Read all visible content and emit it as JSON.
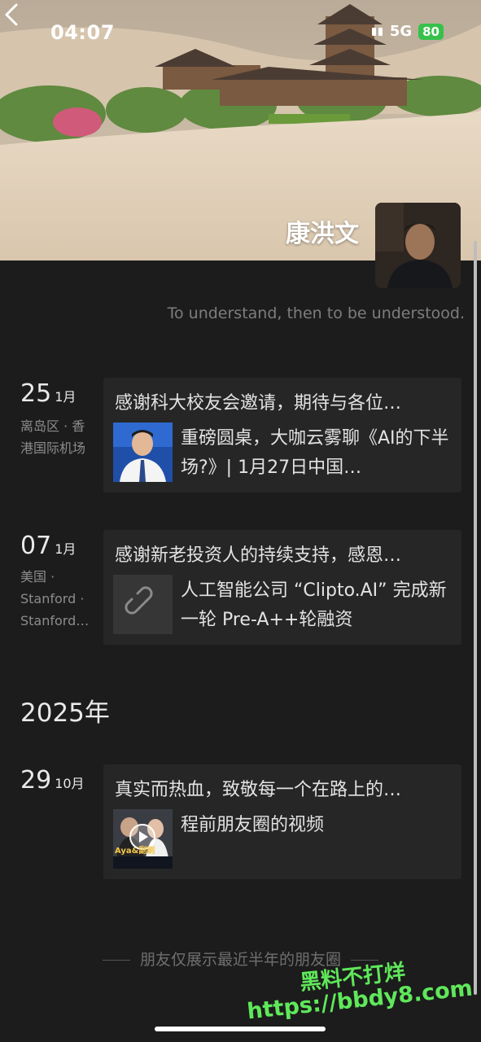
{
  "status_bar": {
    "time": "04:07",
    "network": "5G",
    "battery": "80"
  },
  "profile": {
    "name": "康洪文",
    "signature": "To understand, then to be understood."
  },
  "posts": [
    {
      "day": "25",
      "month": "1月",
      "location": "离岛区 · 香港国际机场",
      "caption": "感谢科大校友会邀请，期待与各位…",
      "link_text": "重磅圆桌，大咖云雾聊《AI的下半场?》| 1月27日中国…",
      "thumb": "person-photo-icon"
    },
    {
      "day": "07",
      "month": "1月",
      "location": "美国 · Stanford · Stanford…",
      "caption": "感谢新老投资人的持续支持，感恩…",
      "link_text": "人工智能公司 “Clipto.AI” 完成新一轮 Pre-A++轮融资",
      "thumb": "link-icon"
    },
    {
      "day": "29",
      "month": "10月",
      "location": "",
      "caption": "真实而热血，致敬每一个在路上的…",
      "link_text": "程前朋友圈的视频",
      "thumb": "video-play-icon",
      "thumb_text": "Aya&副刷"
    }
  ],
  "year_label": "2025年",
  "footer_note": "朋友仅展示最近半年的朋友圈",
  "watermark": {
    "line1": "黑料不打烊",
    "line2": "https://bbdy8.com"
  },
  "colors": {
    "background": "#1c1c1c",
    "card": "#262626",
    "battery": "#36c24a",
    "watermark": "#5fe85a"
  }
}
